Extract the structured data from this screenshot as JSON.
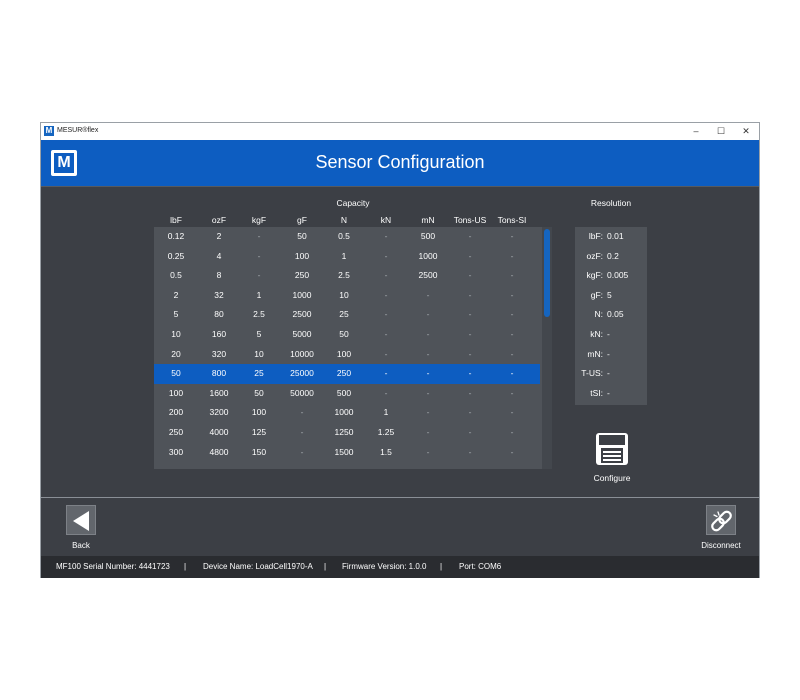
{
  "window": {
    "app_logo": "M",
    "title": "MESUR®flex",
    "minimize": "–",
    "maximize": "☐",
    "close": "✕"
  },
  "header": {
    "logo": "M",
    "title": "Sensor Configuration"
  },
  "capacity": {
    "heading": "Capacity",
    "columns": [
      "lbF",
      "ozF",
      "kgF",
      "gF",
      "N",
      "kN",
      "mN",
      "Tons-US",
      "Tons-SI"
    ],
    "rows": [
      [
        "0.12",
        "2",
        "-",
        "50",
        "0.5",
        "-",
        "500",
        "-",
        "-"
      ],
      [
        "0.25",
        "4",
        "-",
        "100",
        "1",
        "-",
        "1000",
        "-",
        "-"
      ],
      [
        "0.5",
        "8",
        "-",
        "250",
        "2.5",
        "-",
        "2500",
        "-",
        "-"
      ],
      [
        "2",
        "32",
        "1",
        "1000",
        "10",
        "-",
        "-",
        "-",
        "-"
      ],
      [
        "5",
        "80",
        "2.5",
        "2500",
        "25",
        "-",
        "-",
        "-",
        "-"
      ],
      [
        "10",
        "160",
        "5",
        "5000",
        "50",
        "-",
        "-",
        "-",
        "-"
      ],
      [
        "20",
        "320",
        "10",
        "10000",
        "100",
        "-",
        "-",
        "-",
        "-"
      ],
      [
        "50",
        "800",
        "25",
        "25000",
        "250",
        "-",
        "-",
        "-",
        "-"
      ],
      [
        "100",
        "1600",
        "50",
        "50000",
        "500",
        "-",
        "-",
        "-",
        "-"
      ],
      [
        "200",
        "3200",
        "100",
        "-",
        "1000",
        "1",
        "-",
        "-",
        "-"
      ],
      [
        "250",
        "4000",
        "125",
        "-",
        "1250",
        "1.25",
        "-",
        "-",
        "-"
      ],
      [
        "300",
        "4800",
        "150",
        "-",
        "1500",
        "1.5",
        "-",
        "-",
        "-"
      ]
    ],
    "selected_row": 7
  },
  "resolution": {
    "heading": "Resolution",
    "items": [
      {
        "label": "lbF:",
        "value": "0.01"
      },
      {
        "label": "ozF:",
        "value": "0.2"
      },
      {
        "label": "kgF:",
        "value": "0.005"
      },
      {
        "label": "gF:",
        "value": "5"
      },
      {
        "label": "N:",
        "value": "0.05"
      },
      {
        "label": "kN:",
        "value": "-"
      },
      {
        "label": "mN:",
        "value": "-"
      },
      {
        "label": "T-US:",
        "value": "-"
      },
      {
        "label": "tSI:",
        "value": "-"
      }
    ]
  },
  "actions": {
    "configure": "Configure",
    "back": "Back",
    "disconnect": "Disconnect"
  },
  "status": {
    "serial": "MF100 Serial Number: 4441723",
    "device": "Device Name: LoadCell1970-A",
    "firmware": "Firmware Version: 1.0.0",
    "port": "Port: COM6",
    "separator": "|"
  },
  "colors": {
    "accent": "#0d5dc1",
    "background": "#3c3f45",
    "panel": "#4f5359",
    "statusbar": "#2a2c30"
  }
}
